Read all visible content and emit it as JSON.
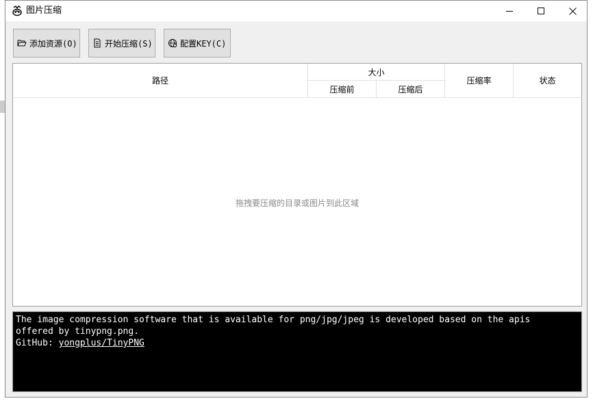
{
  "window": {
    "title": "图片压缩"
  },
  "toolbar": {
    "add_label": "添加资源(O)",
    "start_label": "开始压缩(S)",
    "config_label": "配置KEY(C)"
  },
  "table": {
    "columns": {
      "path": "路径",
      "size": "大小",
      "size_before": "压缩前",
      "size_after": "压缩后",
      "rate": "压缩率",
      "status": "状态"
    },
    "empty_hint": "拖拽要压缩的目录或图片到此区域"
  },
  "console": {
    "line1": "The image compression software that is available for png/jpg/jpeg is developed based on the apis",
    "line2": "offered by tinypng.png.",
    "github_prefix": "GitHub: ",
    "github_link": "yongplus/TinyPNG"
  },
  "colors": {
    "window_bg": "#f0f0f0",
    "button_bg": "#e1e1e1",
    "console_bg": "#000000",
    "console_text": "#ffffff",
    "hint_text": "#8a8a8a"
  }
}
